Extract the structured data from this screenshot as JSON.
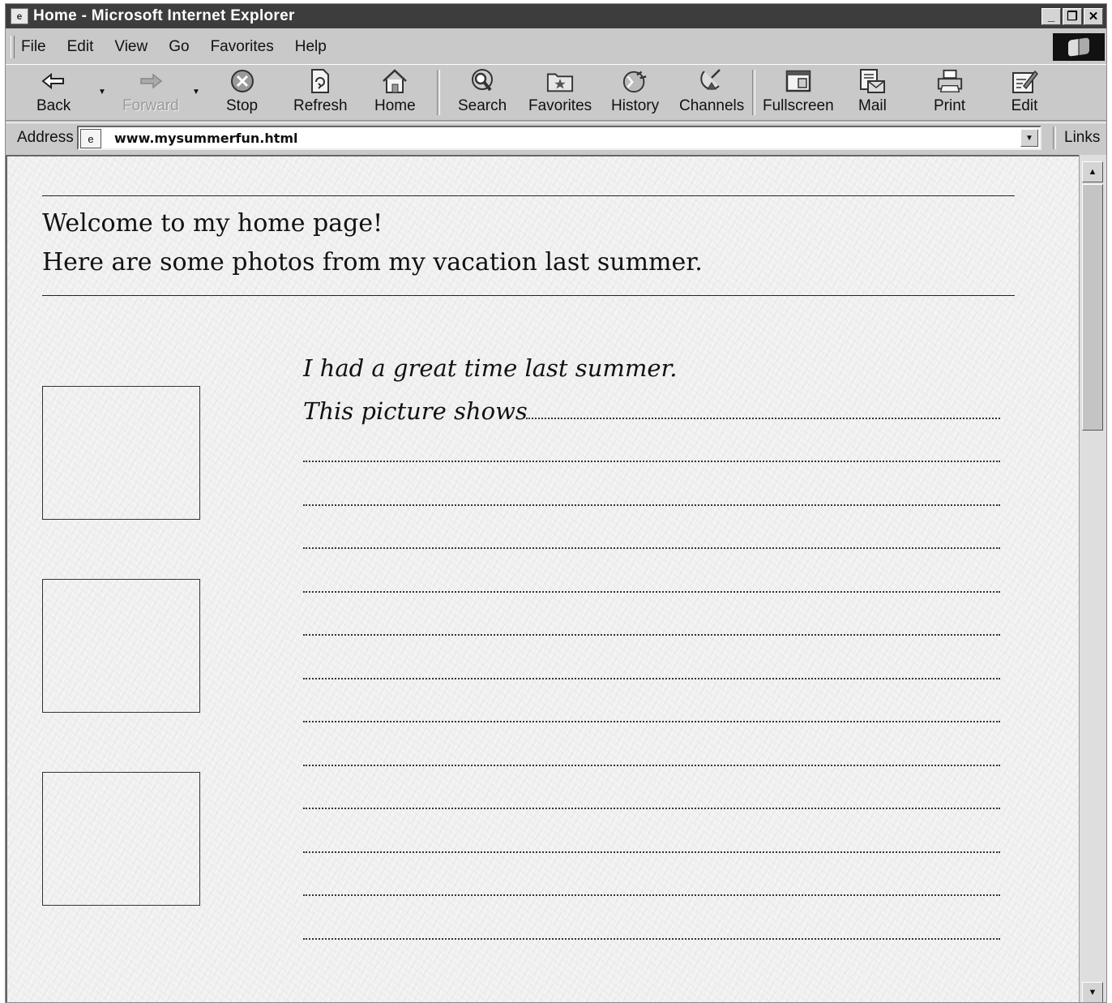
{
  "window": {
    "title": "Home - Microsoft Internet Explorer"
  },
  "menu": [
    "File",
    "Edit",
    "View",
    "Go",
    "Favorites",
    "Help"
  ],
  "toolbar": {
    "back": "Back",
    "forward": "Forward",
    "stop": "Stop",
    "refresh": "Refresh",
    "home": "Home",
    "search": "Search",
    "favorites": "Favorites",
    "history": "History",
    "channels": "Channels",
    "fullscreen": "Fullscreen",
    "mail": "Mail",
    "print": "Print",
    "edit": "Edit"
  },
  "address": {
    "label": "Address",
    "url": "www.mysummerfun.html",
    "links": "Links"
  },
  "page": {
    "welcome": "Welcome to my home page!",
    "subtitle": "Here are some photos from my vacation last summer.",
    "caption_line1": "I had a great time last summer.",
    "caption_line2": "This picture shows"
  },
  "icons": {
    "back": "back-arrow-icon",
    "forward": "forward-arrow-icon",
    "stop": "stop-icon",
    "refresh": "refresh-icon",
    "home": "home-icon",
    "search": "search-icon",
    "favorites": "favorites-folder-icon",
    "history": "history-icon",
    "channels": "channels-icon",
    "fullscreen": "fullscreen-icon",
    "mail": "mail-icon",
    "print": "printer-icon",
    "edit": "edit-icon"
  }
}
